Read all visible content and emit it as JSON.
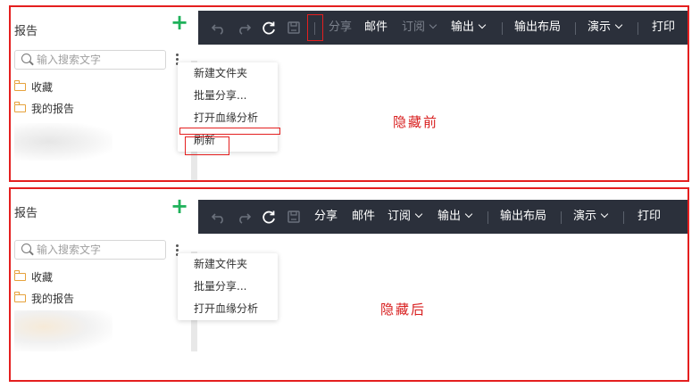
{
  "before": {
    "sidebar_title": "报告",
    "search_placeholder": "输入搜索文字",
    "tree": [
      "收藏",
      "我的报告"
    ],
    "toolbar": {
      "share": "分享",
      "mail": "邮件",
      "subscribe": "订阅",
      "output": "输出",
      "output_layout": "输出布局",
      "present": "演示",
      "print": "打印"
    },
    "menu": [
      "新建文件夹",
      "批量分享...",
      "打开血缘分析",
      "刷新"
    ],
    "annotation": "隐藏前"
  },
  "after": {
    "sidebar_title": "报告",
    "search_placeholder": "输入搜索文字",
    "tree": [
      "收藏",
      "我的报告"
    ],
    "toolbar": {
      "share": "分享",
      "mail": "邮件",
      "subscribe": "订阅",
      "output": "输出",
      "output_layout": "输出布局",
      "present": "演示",
      "print": "打印"
    },
    "menu": [
      "新建文件夹",
      "批量分享...",
      "打开血缘分析"
    ],
    "annotation": "隐藏后"
  },
  "colors": {
    "highlight_red": "#e41f1f",
    "toolbar_bg": "#2b303b",
    "accent_green": "#1fb15a",
    "folder_orange": "#e6a23c"
  },
  "icons": [
    "undo-icon",
    "redo-icon",
    "refresh-icon",
    "save-icon",
    "search-icon",
    "folder-icon",
    "plus-icon",
    "more-vertical-icon"
  ]
}
